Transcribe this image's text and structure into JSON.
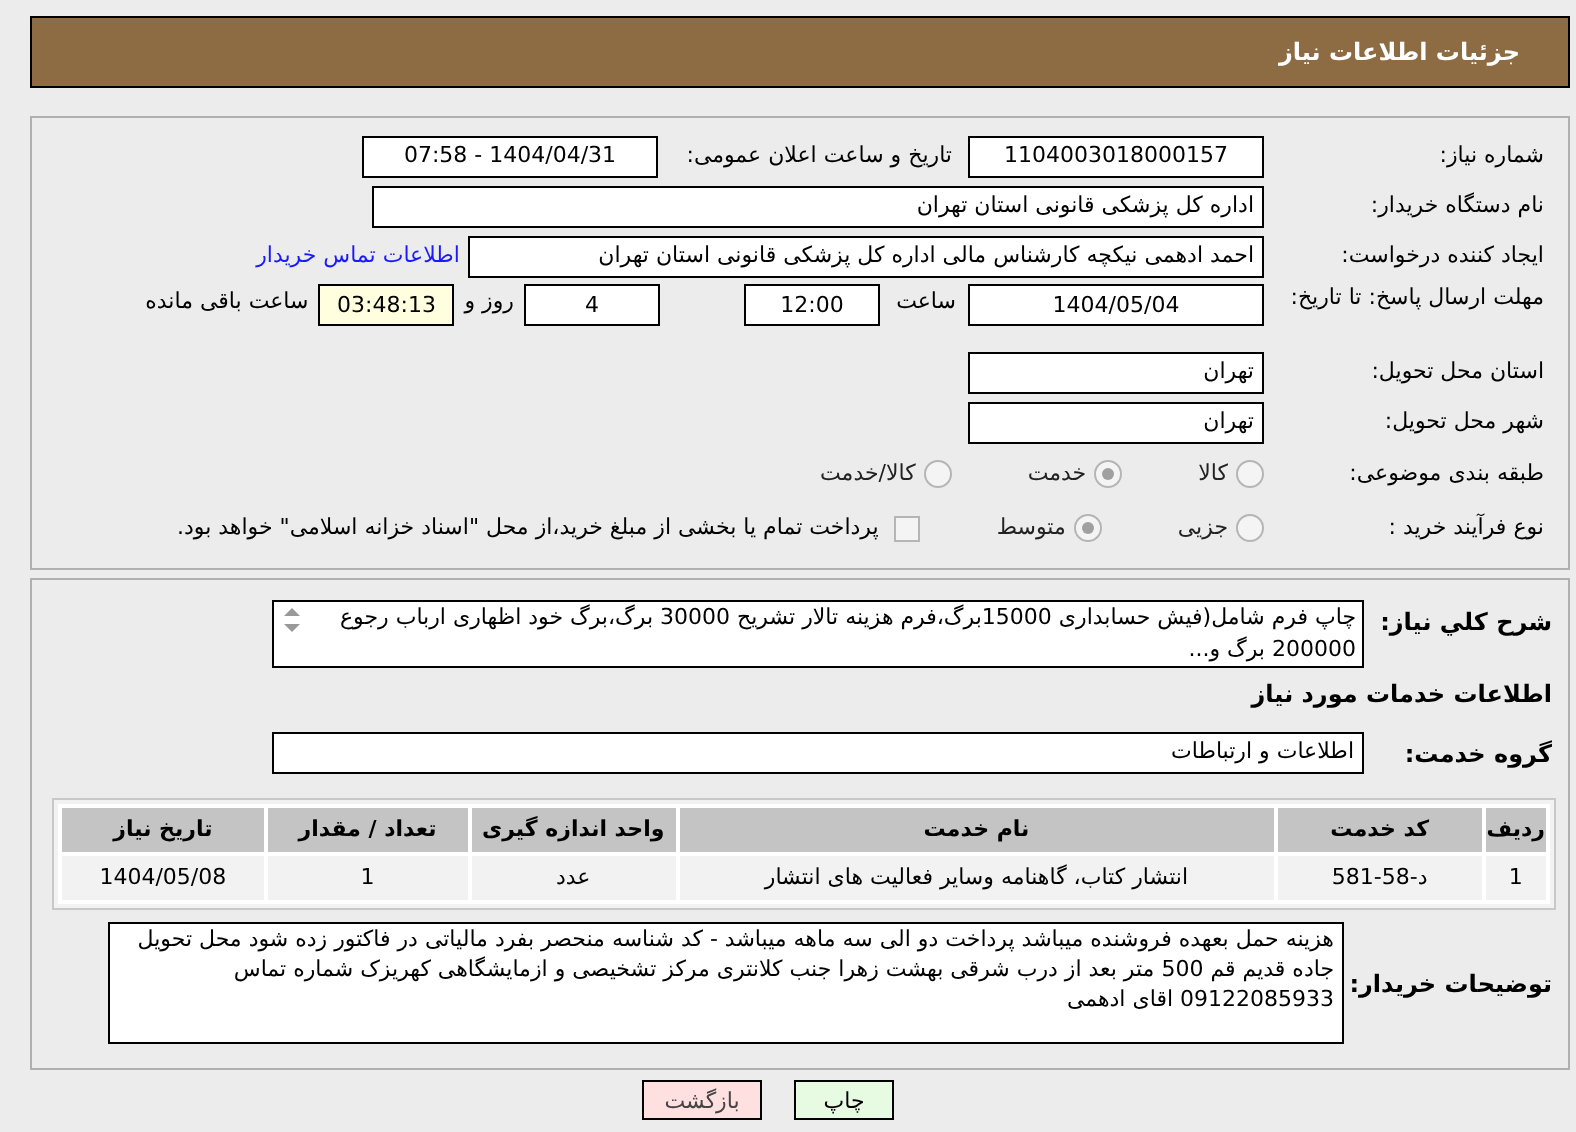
{
  "header": {
    "title": "جزئیات اطلاعات نیاز"
  },
  "need_number": {
    "label": "شماره نیاز:",
    "value": "1104003018000157"
  },
  "announce": {
    "label": "تاریخ و ساعت اعلان عمومی:",
    "value": "1404/04/31 - 07:58"
  },
  "buyer_org": {
    "label": "نام دستگاه خریدار:",
    "value": "اداره کل پزشکی قانونی استان تهران"
  },
  "creator": {
    "label": "ایجاد کننده درخواست:",
    "value": "احمد ادهمی نیکچه کارشناس مالی اداره کل پزشکی قانونی استان تهران",
    "link": "اطلاعات تماس خریدار"
  },
  "deadline": {
    "label": "مهلت ارسال پاسخ: تا تاریخ:",
    "date": "1404/05/04",
    "time_label": "ساعت",
    "time": "12:00",
    "days": "4",
    "days_label": "روز و",
    "remaining": "03:48:13",
    "remaining_label": "ساعت باقی مانده"
  },
  "province": {
    "label": "استان محل تحویل:",
    "value": "تهران"
  },
  "city": {
    "label": "شهر محل تحویل:",
    "value": "تهران"
  },
  "category": {
    "label": "طبقه بندی موضوعی:",
    "options": [
      {
        "label": "کالا",
        "selected": false
      },
      {
        "label": "خدمت",
        "selected": true
      },
      {
        "label": "کالا/خدمت",
        "selected": false
      }
    ]
  },
  "purchase_type": {
    "label": "نوع فرآیند خرید :",
    "options": [
      {
        "label": "جزیی",
        "selected": false
      },
      {
        "label": "متوسط",
        "selected": true
      }
    ],
    "treasury": {
      "checked": false,
      "label": "پرداخت تمام یا بخشی از مبلغ خرید،از محل \"اسناد خزانه اسلامی\" خواهد بود."
    }
  },
  "description": {
    "label": "شرح کلي نياز:",
    "value": "چاپ فرم شامل(فیش حسابداری 15000برگ،فرم هزینه تالار تشریح 30000 برگ،برگ خود اظهاری ارباب رجوع 200000 برگ و..."
  },
  "services_heading": "اطلاعات خدمات مورد نیاز",
  "service_group": {
    "label": "گروه خدمت:",
    "value": "اطلاعات و ارتباطات"
  },
  "table": {
    "columns": [
      "ردیف",
      "کد خدمت",
      "نام خدمت",
      "واحد اندازه گیری",
      "تعداد / مقدار",
      "تاریخ نیاز"
    ],
    "rows": [
      [
        "1",
        "د-58-581",
        "انتشار کتاب، گاهنامه وسایر فعالیت های انتشار",
        "عدد",
        "1",
        "1404/05/08"
      ]
    ]
  },
  "buyer_notes": {
    "label": "توضیحات خریدار:",
    "value": "هزینه حمل بعهده فروشنده میباشد پرداخت دو الی سه ماهه میباشد - کد شناسه منحصر بفرد مالیاتی در فاکتور زده شود محل تحویل جاده قدیم قم 500 متر بعد از درب شرقی بهشت زهرا جنب کلانتری مرکز تشخیصی و ازمایشگاهی کهریزک شماره تماس 09122085933 اقای ادهمی"
  },
  "buttons": [
    {
      "label": "چاپ",
      "kind": "print"
    },
    {
      "label": "بازگشت",
      "kind": "back"
    }
  ]
}
